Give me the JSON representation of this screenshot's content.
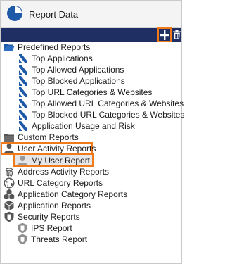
{
  "window": {
    "title": "Report Data"
  },
  "toolbar": {
    "add_icon": "plus-icon",
    "delete_icon": "trash-icon"
  },
  "colors": {
    "toolbar_bg": "#1f2f63",
    "highlight": "#f07a1a",
    "icon_blue": "#1e5aa8"
  },
  "tree": {
    "predefined": {
      "label": "Predefined Reports",
      "items": [
        "Top Applications",
        "Top Allowed Applications",
        "Top Blocked Applications",
        "Top URL Categories & Websites",
        "Top Allowed URL Categories & Websites",
        "Top Blocked URL Categories & Websites",
        "Application Usage and Risk"
      ]
    },
    "custom": {
      "label": "Custom Reports"
    },
    "user_activity": {
      "label": "User Activity Reports",
      "child": "My User Report"
    },
    "others": [
      "Address Activity Reports",
      "URL Category Reports",
      "Application Category Reports",
      "Application Reports"
    ],
    "security": {
      "label": "Security Reports",
      "items": [
        "IPS Report",
        "Threats Report"
      ]
    }
  }
}
